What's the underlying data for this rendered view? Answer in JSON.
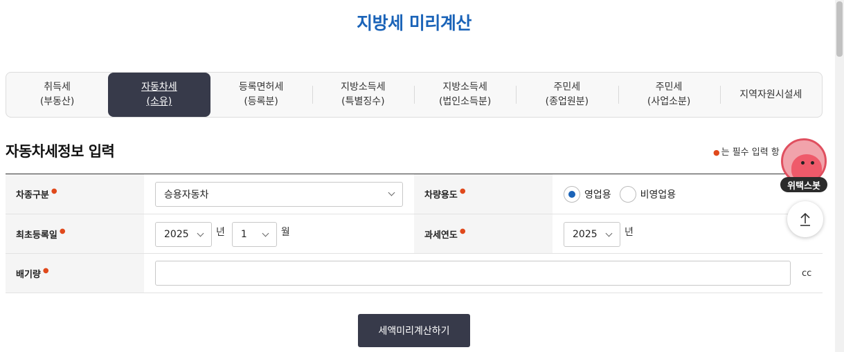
{
  "page_title": "지방세 미리계산",
  "tabs": [
    {
      "line1": "취득세",
      "line2": "(부동산)",
      "active": false
    },
    {
      "line1": "자동차세",
      "line2": "(소유)",
      "active": true
    },
    {
      "line1": "등록면허세",
      "line2": "(등록분)",
      "active": false
    },
    {
      "line1": "지방소득세",
      "line2": "(특별징수)",
      "active": false
    },
    {
      "line1": "지방소득세",
      "line2": "(법인소득분)",
      "active": false
    },
    {
      "line1": "주민세",
      "line2": "(종업원분)",
      "active": false
    },
    {
      "line1": "주민세",
      "line2": "(사업소분)",
      "active": false
    },
    {
      "line1": "지역자원시설세",
      "line2": "",
      "active": false
    }
  ],
  "section_title": "자동차세정보 입력",
  "required_note": "는 필수 입력 항",
  "form": {
    "vehicle_type": {
      "label": "차종구분",
      "value": "승용자동차"
    },
    "vehicle_use": {
      "label": "차량용도",
      "options": [
        "영업용",
        "비영업용"
      ],
      "selected": "영업용"
    },
    "first_registration": {
      "label": "최초등록일",
      "year": "2025",
      "year_unit": "년",
      "month": "1",
      "month_unit": "월"
    },
    "tax_year": {
      "label": "과세연도",
      "year": "2025",
      "year_unit": "년"
    },
    "displacement": {
      "label": "배기량",
      "value": "",
      "unit": "cc"
    }
  },
  "submit_label": "세액미리계산하기",
  "chatbot_label": "위택스봇",
  "colors": {
    "accent": "#1a63b8",
    "dark": "#373a4a",
    "required": "#e0491c"
  }
}
